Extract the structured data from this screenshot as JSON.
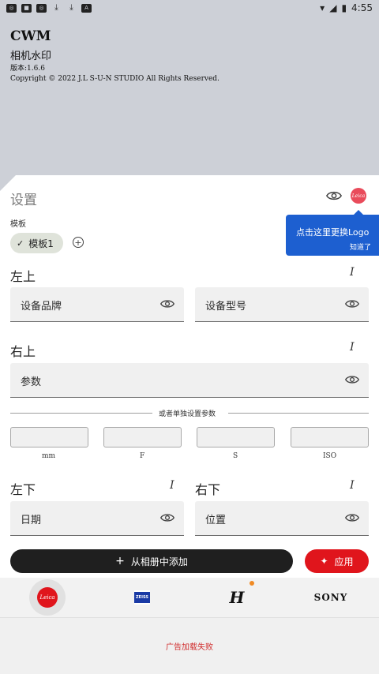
{
  "status_bar": {
    "time": "4:55",
    "left_icons": [
      "cwm-notification-icon",
      "stop-icon",
      "cwm-notification-icon",
      "download-icon",
      "download-icon",
      "app-notification-icon"
    ],
    "right_icons": [
      "wifi-icon",
      "cellular-icon",
      "battery-icon"
    ]
  },
  "app": {
    "name": "CWM",
    "subtitle": "相机水印",
    "version": "版本:1.6.6",
    "copyright": "Copyright © 2022 J.L S-U-N STUDIO All Rights Reserved."
  },
  "settings": {
    "title": "设置",
    "template_label": "模板",
    "template_chip": "模板1",
    "tooltip": {
      "text": "点击这里更换Logo",
      "dismiss": "知道了"
    },
    "sections": {
      "top_left": {
        "title": "左上",
        "fields": [
          "设备品牌",
          "设备型号"
        ]
      },
      "top_right": {
        "title": "右上",
        "field": "参数"
      },
      "divider_text": "或者单独设置参数",
      "params": [
        "mm",
        "F",
        "S",
        "ISO"
      ],
      "bottom_left": {
        "title": "左下",
        "field": "日期"
      },
      "bottom_right": {
        "title": "右下",
        "field": "位置"
      }
    },
    "buttons": {
      "add_from_album": "从相册中添加",
      "apply": "应用"
    }
  },
  "brands": {
    "leica_logo_text": "Leica",
    "zeiss_logo_text": "ZEISS",
    "hasselblad_logo_text": "H",
    "sony": "SONY"
  },
  "ad": {
    "message": "广告加载失败"
  },
  "colors": {
    "accent_red": "#e0151c",
    "tooltip_blue": "#1d5fd0",
    "header_bg": "#cdd0d7",
    "notification_dot": "#f08a24"
  }
}
